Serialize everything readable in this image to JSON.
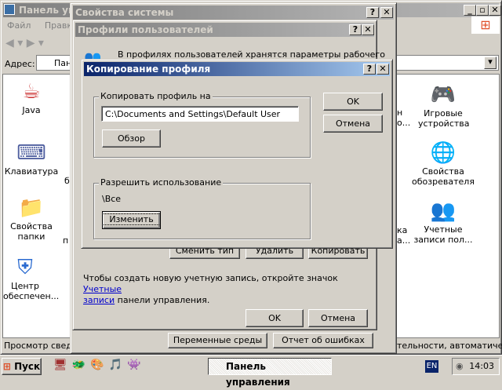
{
  "control_panel": {
    "title": "Панель управления",
    "menu": [
      "Файл",
      "Правка"
    ],
    "address_label": "Адрес:",
    "address_value": "Панель управления",
    "status_left": "Просмотр сведен",
    "status_right": "тельности, автоматически",
    "icons_left": [
      {
        "label": "Java",
        "icon": "java-icon"
      },
      {
        "label": "Клавиатура",
        "icon": "keyboard-icon"
      },
      {
        "label": "Свойства папки",
        "icon": "folder-options-icon"
      },
      {
        "label": "Центр обеспечен...",
        "icon": "security-center-icon"
      }
    ],
    "icons_right": [
      {
        "label": "Игровые устройства",
        "icon": "gamepad-icon"
      },
      {
        "label": "Свойства обозревателя",
        "icon": "internet-options-icon"
      },
      {
        "label": "Учетные записи пол...",
        "icon": "user-accounts-icon"
      }
    ],
    "partial_mid": [
      "н",
      "о...",
      "ка",
      "а..."
    ],
    "partial_left": [
      "б",
      "п"
    ]
  },
  "system_properties": {
    "title": "Свойства системы",
    "env_button": "Переменные среды",
    "error_button": "Отчет об ошибках"
  },
  "profiles": {
    "title": "Профили пользователей",
    "description": "В профилях пользователей хранятся параметры рабочего",
    "change_type": "Сменить тип",
    "delete": "Удалить",
    "copy": "Копировать",
    "hint_text": "Чтобы создать новую учетную запись, откройте значок ",
    "hint_link1": "Учетные",
    "hint_link2": "записи",
    "hint_tail": " панели управления.",
    "ok": "OK",
    "cancel": "Отмена"
  },
  "copy_profile": {
    "title": "Копирование профиля",
    "copy_to_label": "Копировать профиль на",
    "path_value": "C:\\Documents and Settings\\Default User",
    "browse": "Обзор",
    "permit_label": "Разрешить использование",
    "permit_value": "\\Все",
    "change": "Изменить",
    "ok": "OK",
    "cancel": "Отмена"
  },
  "taskbar": {
    "start": "Пуск",
    "task": "Панель управления",
    "lang": "EN",
    "clock": "14:03"
  },
  "colors": {
    "active_title": "#0a246a",
    "inactive_title": "#808080",
    "face": "#d4d0c8"
  }
}
